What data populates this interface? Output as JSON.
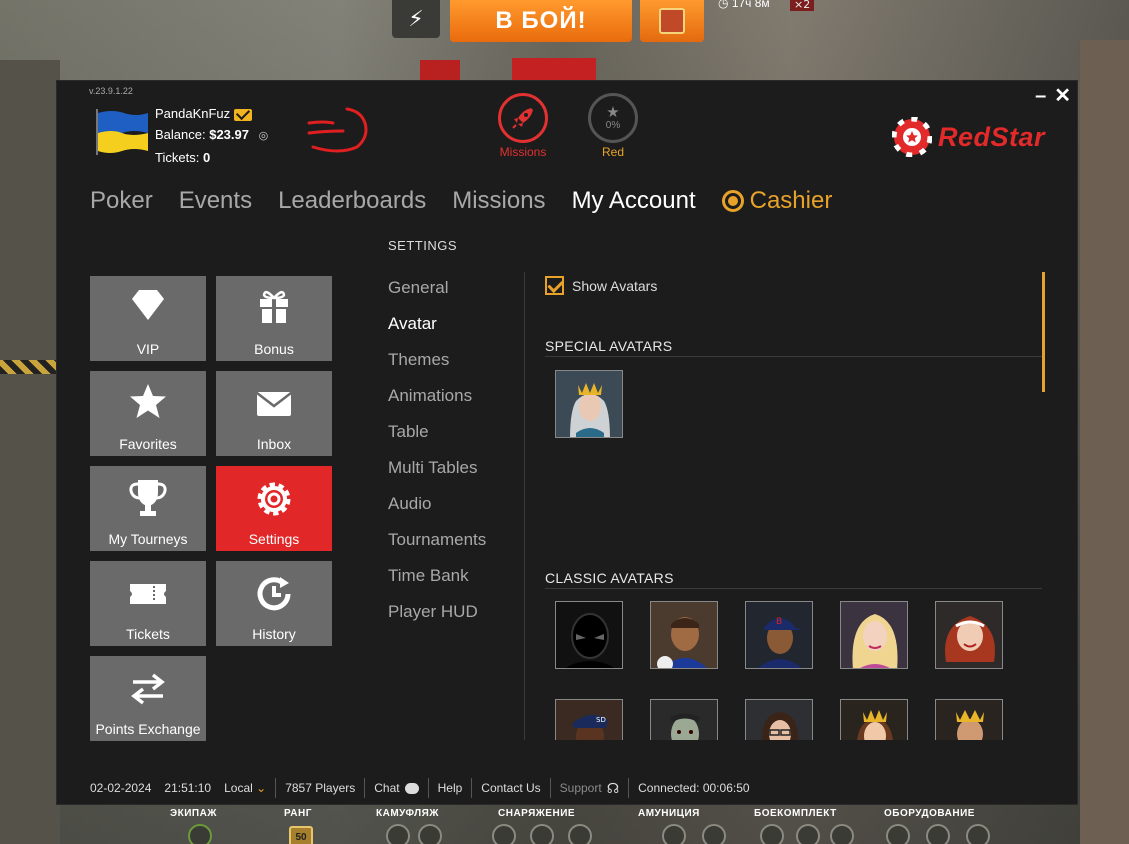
{
  "game": {
    "battle_button": "В БОЙ!",
    "timer": "17ч 8м",
    "multiplier": "×2",
    "bottom_labels": [
      "ЭКИПАЖ",
      "РАНГ",
      "КАМУФЛЯЖ",
      "СНАРЯЖЕНИЕ",
      "АМУНИЦИЯ",
      "БОЕКОМПЛЕКТ",
      "ОБОРУДОВАНИЕ"
    ],
    "rank_value": "50"
  },
  "window": {
    "version": "v.23.9.1.22",
    "minimize": "–",
    "close": "✕"
  },
  "user": {
    "name": "PandaKnFuz",
    "balance_label": "Balance:",
    "balance": "$23.97",
    "tickets_label": "Tickets:",
    "tickets": "0"
  },
  "badges": {
    "missions_label": "Missions",
    "level_label": "Red",
    "level_progress": "0%"
  },
  "brand": {
    "name": "RedStar"
  },
  "nav": {
    "items": [
      "Poker",
      "Events",
      "Leaderboards",
      "Missions",
      "My Account",
      "Cashier"
    ],
    "active": "My Account"
  },
  "tiles": [
    {
      "label": "VIP",
      "icon": "diamond-icon"
    },
    {
      "label": "Bonus",
      "icon": "gift-icon"
    },
    {
      "label": "Favorites",
      "icon": "star-icon"
    },
    {
      "label": "Inbox",
      "icon": "envelope-icon"
    },
    {
      "label": "My Tourneys",
      "icon": "trophy-icon"
    },
    {
      "label": "Settings",
      "icon": "gear-icon"
    },
    {
      "label": "Tickets",
      "icon": "ticket-icon"
    },
    {
      "label": "History",
      "icon": "history-icon"
    },
    {
      "label": "Points Exchange",
      "icon": "exchange-icon"
    }
  ],
  "settings": {
    "title": "SETTINGS",
    "menu": [
      "General",
      "Avatar",
      "Themes",
      "Animations",
      "Table",
      "Multi Tables",
      "Audio",
      "Tournaments",
      "Time Bank",
      "Player HUD"
    ],
    "active": "Avatar",
    "show_avatars_label": "Show Avatars",
    "show_avatars_checked": true,
    "special_header": "SPECIAL AVATARS",
    "classic_header": "CLASSIC AVATARS"
  },
  "status": {
    "date": "02-02-2024",
    "time": "21:51:10",
    "timezone": "Local",
    "players": "7857 Players",
    "chat": "Chat",
    "help": "Help",
    "contact": "Contact Us",
    "support": "Support",
    "connected": "Connected: 00:06:50"
  },
  "colors": {
    "accent_orange": "#e8a22a",
    "brand_red": "#e12727",
    "panel_bg": "#1c1c1c",
    "tile_bg": "#6a6a6a"
  }
}
